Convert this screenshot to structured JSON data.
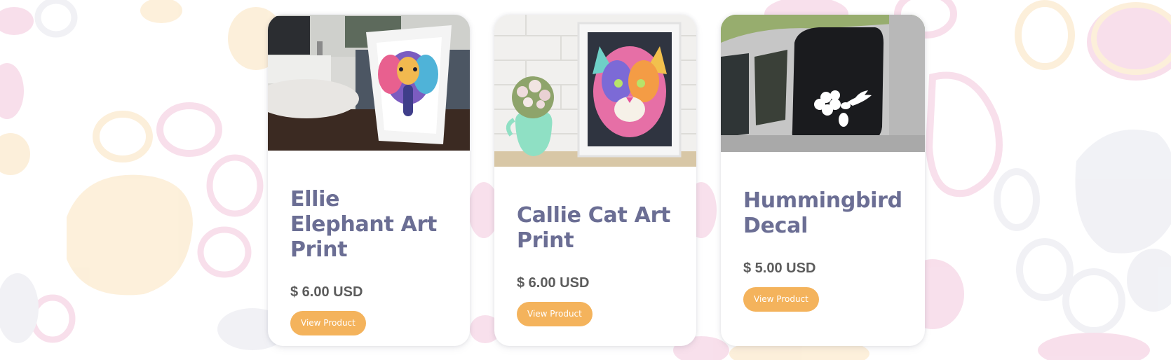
{
  "products": [
    {
      "title": "Ellie Elephant Art Print",
      "price": "$ 6.00 USD",
      "button_label": "View Product"
    },
    {
      "title": "Callie Cat Art Print",
      "price": "$ 6.00 USD",
      "button_label": "View Product"
    },
    {
      "title": "Hummingbird Decal",
      "price": "$ 5.00 USD",
      "button_label": "View Product"
    }
  ],
  "colors": {
    "title": "#6b6e94",
    "price": "#5c5c5c",
    "button": "#f4b35c",
    "paw_pink": "#f3c6dc",
    "paw_yellow": "#fbe3bd",
    "paw_gray": "#e6e7ee"
  }
}
